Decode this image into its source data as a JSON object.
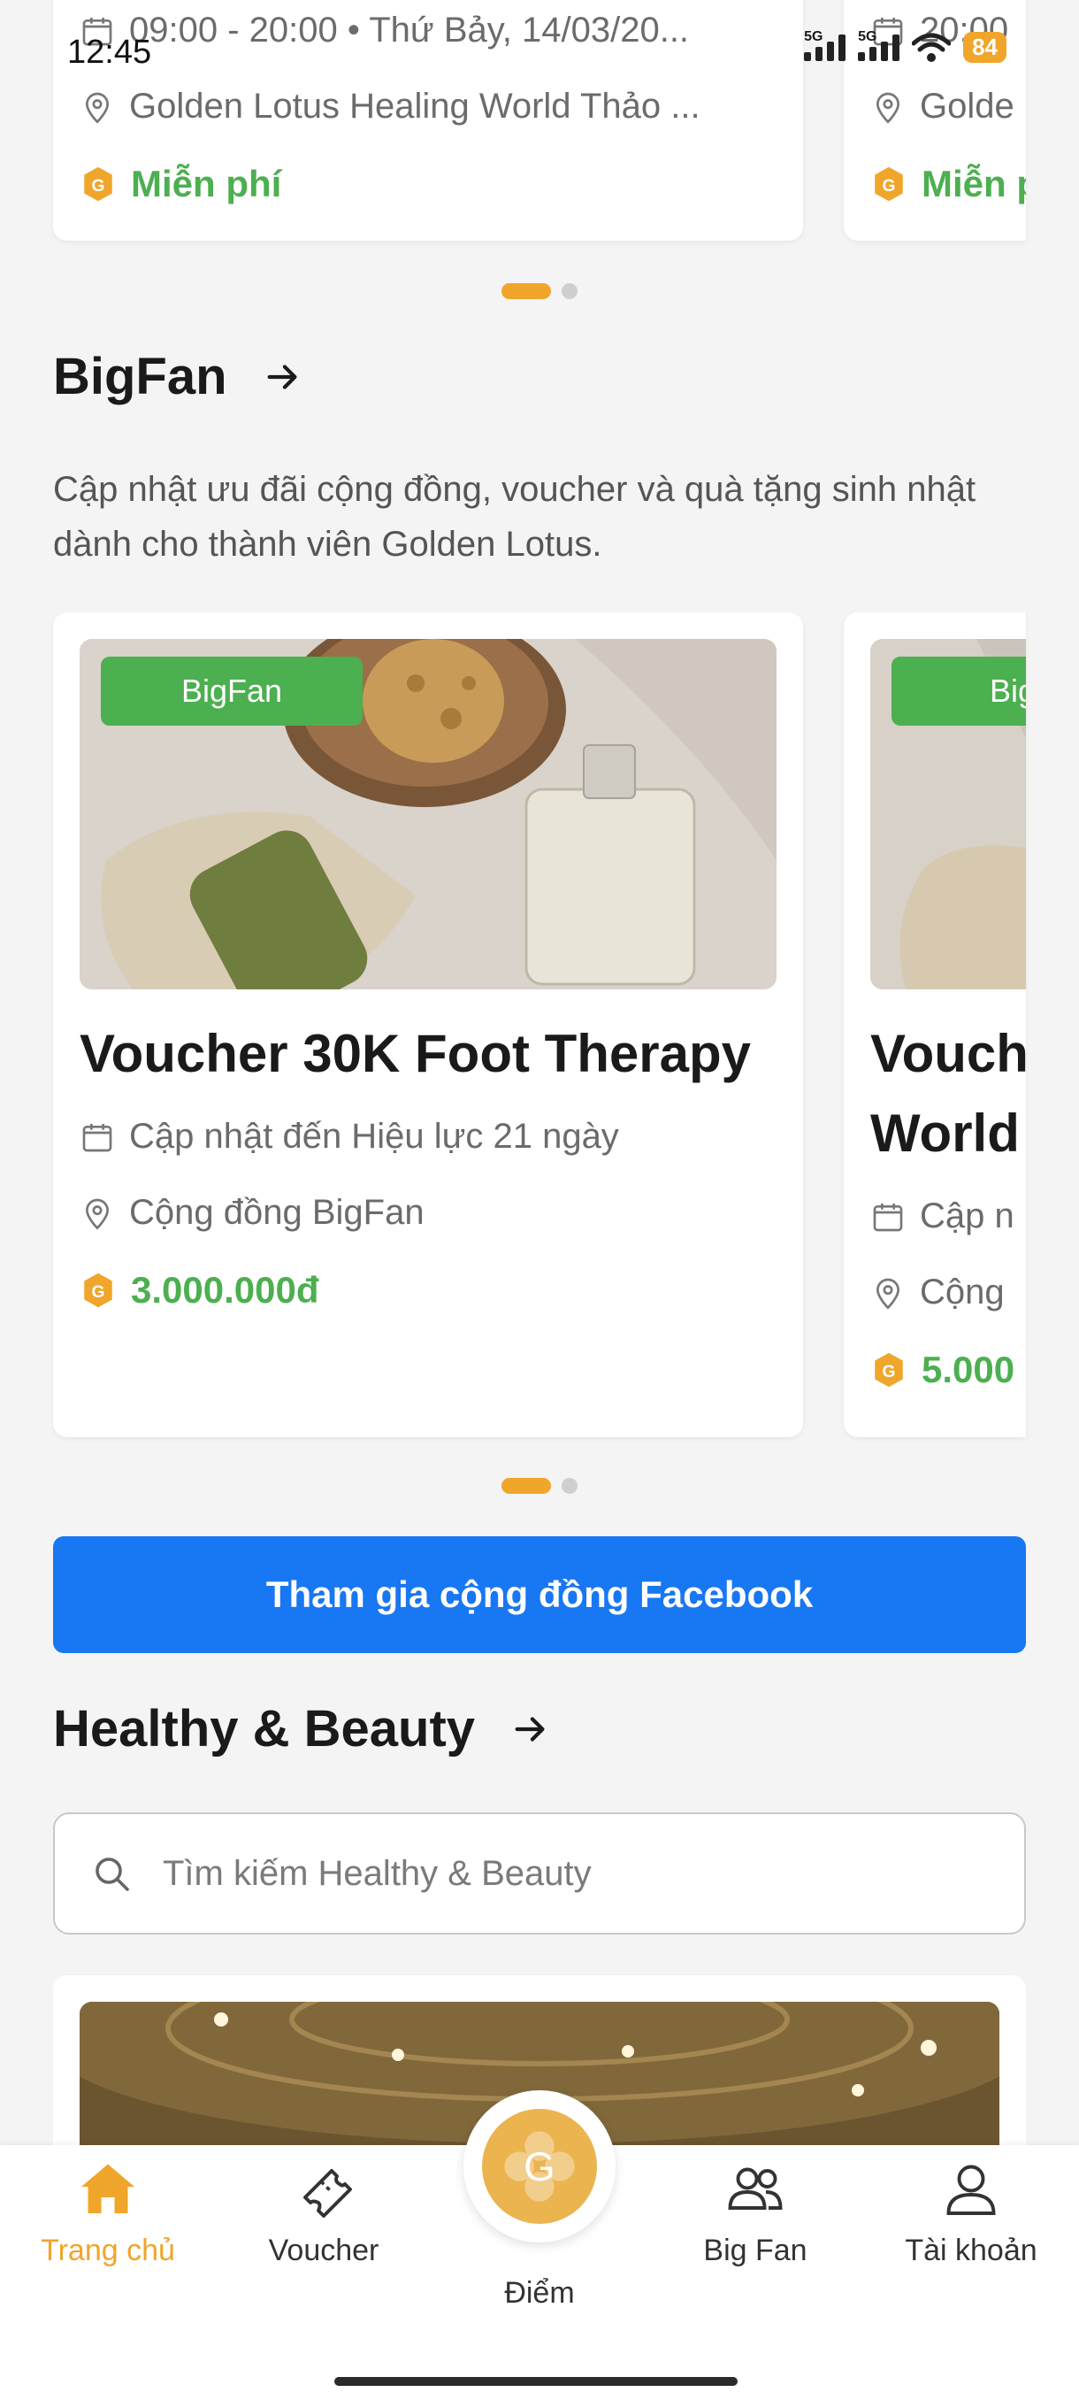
{
  "status_bar": {
    "time": "12:45",
    "signal_1": "5G",
    "signal_2": "5G",
    "battery": "84"
  },
  "events": {
    "cards": [
      {
        "time": "09:00 - 20:00 • Thứ Bảy, 14/03/20...",
        "location": "Golden Lotus Healing World Thảo ...",
        "price": "Miễn phí"
      },
      {
        "time": "20:00",
        "location": "Golde",
        "price": "Miễn p"
      }
    ]
  },
  "bigfan": {
    "title": "BigFan",
    "description": "Cập nhật ưu đãi cộng đồng, voucher và quà tặng sinh nhật dành cho thành viên Golden Lotus.",
    "cards": [
      {
        "badge": "BigFan",
        "title": "Voucher 30K Foot Therapy",
        "validity": "Cập nhật đến Hiệu lực 21 ngày",
        "location": "Cộng đồng BigFan",
        "price": "3.000.000đ"
      },
      {
        "badge": "BigF",
        "title_line1": "Vouch",
        "title_line2": "World",
        "validity": "Cập n",
        "location": "Cộng",
        "price": "5.000"
      }
    ],
    "facebook_button": "Tham gia cộng đồng Facebook"
  },
  "healthy": {
    "title": "Healthy & Beauty",
    "search_placeholder": "Tìm kiếm Healthy & Beauty"
  },
  "nav": {
    "items": [
      {
        "label": "Trang chủ",
        "icon": "home-icon",
        "active": true
      },
      {
        "label": "Voucher",
        "icon": "ticket-icon",
        "active": false
      },
      {
        "label": "Điểm",
        "icon": "points-icon",
        "active": false
      },
      {
        "label": "Big Fan",
        "icon": "users-icon",
        "active": false
      },
      {
        "label": "Tài khoản",
        "icon": "account-icon",
        "active": false
      }
    ],
    "center_letter": "G"
  },
  "colors": {
    "accent": "#f0a52b",
    "green": "#4caf50",
    "facebook": "#1877f2"
  }
}
